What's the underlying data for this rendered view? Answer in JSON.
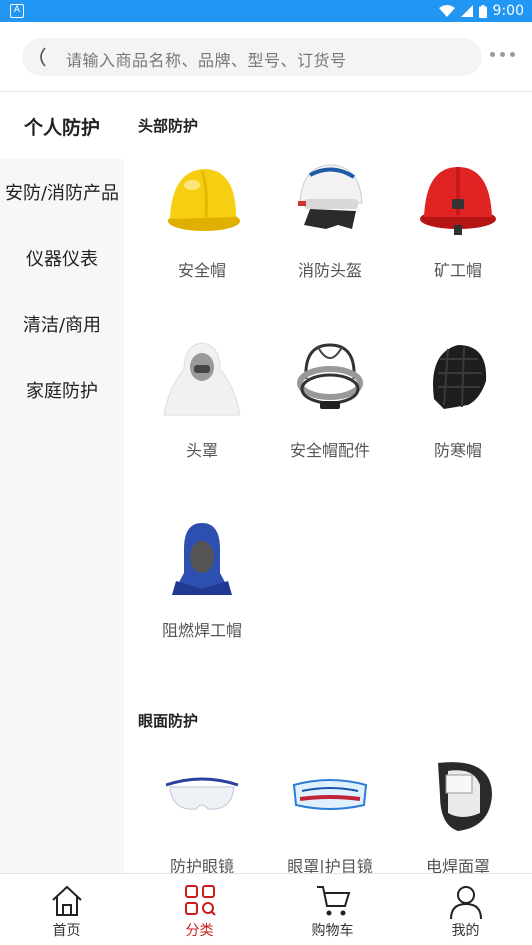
{
  "status_bar": {
    "time": "9:00"
  },
  "search": {
    "placeholder": "请输入商品名称、品牌、型号、订货号"
  },
  "sidebar": {
    "items": [
      {
        "label": "个人防护",
        "active": true
      },
      {
        "label": "安防/消防产品",
        "active": false
      },
      {
        "label": "仪器仪表",
        "active": false
      },
      {
        "label": "清洁/商用",
        "active": false
      },
      {
        "label": "家庭防护",
        "active": false
      }
    ]
  },
  "sections": [
    {
      "title": "头部防护",
      "products": [
        {
          "label": "安全帽",
          "icon": "yellow-hard-hat-icon"
        },
        {
          "label": "消防头盔",
          "icon": "fire-helmet-icon"
        },
        {
          "label": "矿工帽",
          "icon": "red-hard-hat-icon"
        },
        {
          "label": "头罩",
          "icon": "protective-hood-icon"
        },
        {
          "label": "安全帽配件",
          "icon": "helmet-suspension-icon"
        },
        {
          "label": "防寒帽",
          "icon": "winter-cap-icon"
        },
        {
          "label": "阻燃焊工帽",
          "icon": "welding-cap-icon"
        }
      ]
    },
    {
      "title": "眼面防护",
      "products": [
        {
          "label": "防护眼镜",
          "icon": "safety-glasses-icon"
        },
        {
          "label": "眼罩|护目镜",
          "icon": "goggles-icon"
        },
        {
          "label": "电焊面罩",
          "icon": "welding-mask-icon"
        }
      ]
    }
  ],
  "tabbar": {
    "items": [
      {
        "label": "首页",
        "icon": "home-icon",
        "active": false
      },
      {
        "label": "分类",
        "icon": "category-icon",
        "active": true
      },
      {
        "label": "购物车",
        "icon": "cart-icon",
        "active": false
      },
      {
        "label": "我的",
        "icon": "user-icon",
        "active": false
      }
    ]
  },
  "colors": {
    "statusbar": "#2196f3",
    "accent": "#c81e1e"
  }
}
